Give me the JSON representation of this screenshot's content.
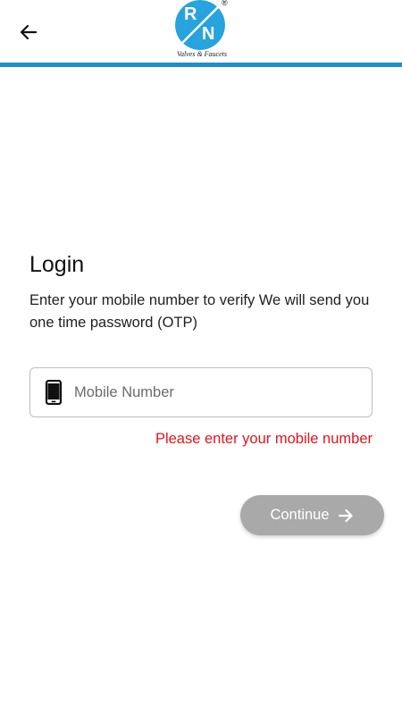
{
  "colors": {
    "accent": "#1f8ecb",
    "logo_blue": "#27a3dd",
    "error": "#e4141b",
    "button_disabled": "#a9a9a9",
    "border": "#bdbdbd"
  },
  "header": {
    "back_icon": "arrow-left-icon",
    "logo": {
      "letter_top": "R",
      "letter_bottom": "N",
      "registered": "®",
      "tagline": "Valves & Faucets"
    }
  },
  "login": {
    "title": "Login",
    "subtitle": "Enter your mobile number to verify We will send you one time password (OTP)",
    "mobile_field": {
      "icon": "smartphone-icon",
      "placeholder": "Mobile Number",
      "value": ""
    },
    "error": "Please enter your mobile number",
    "continue_button": {
      "label": "Continue",
      "icon": "arrow-right-icon",
      "enabled": false
    }
  }
}
